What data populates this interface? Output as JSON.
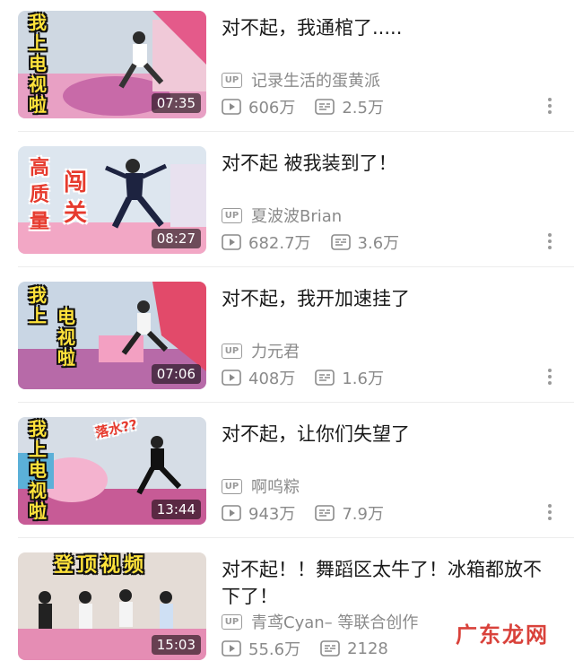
{
  "colors": {
    "accent": "#e63b2e",
    "caption": "#ffe33b",
    "meta": "#8a8a8a"
  },
  "icons": {
    "up": "up-badge-icon",
    "play": "play-icon",
    "danmaku": "danmaku-icon",
    "more": "more-vertical-icon"
  },
  "up_badge": "UP",
  "videos": [
    {
      "title": "对不起，我通棺了.....",
      "uploader": "记录生活的蛋黄派",
      "views": "606万",
      "comments": "2.5万",
      "duration": "07:35",
      "thumb_text": [
        "我",
        "上",
        "电",
        "视",
        "啦"
      ]
    },
    {
      "title": "对不起  被我装到了！",
      "uploader": "夏波波Brian",
      "views": "682.7万",
      "comments": "3.6万",
      "duration": "08:27",
      "thumb_text": [
        "高",
        "质",
        "量",
        "闯",
        "关"
      ]
    },
    {
      "title": "对不起，我开加速挂了",
      "uploader": "力元君",
      "views": "408万",
      "comments": "1.6万",
      "duration": "07:06",
      "thumb_text": [
        "我",
        "上",
        "电",
        "视",
        "啦"
      ]
    },
    {
      "title": "对不起，让你们失望了",
      "uploader": "啊呜粽",
      "views": "943万",
      "comments": "7.9万",
      "duration": "13:44",
      "thumb_text": [
        "我",
        "上",
        "电",
        "视",
        "啦",
        "落水??"
      ]
    },
    {
      "title": "对不起！！舞蹈区太牛了！冰箱都放不下了！",
      "uploader": "青鸢Cyan–  等联合创作",
      "views": "55.6万",
      "comments": "2128",
      "duration": "15:03",
      "thumb_text": [
        "登顶视频"
      ]
    }
  ],
  "watermark": "广东龙网"
}
